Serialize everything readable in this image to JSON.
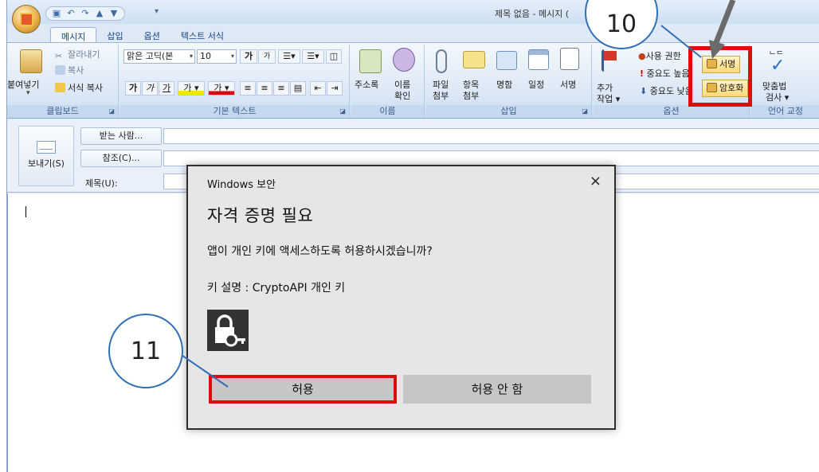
{
  "window": {
    "title": "제목 없음 - 메시지 (",
    "qat_icons": [
      "save-icon",
      "undo-icon",
      "redo-icon",
      "up-icon",
      "down-icon"
    ]
  },
  "tabs": [
    "메시지",
    "삽입",
    "옵션",
    "텍스트 서식"
  ],
  "ribbon": {
    "clipboard": {
      "label": "클립보드",
      "paste": "붙여넣기",
      "cut": "잘라내기",
      "copy": "복사",
      "format_painter": "서식 복사"
    },
    "basic_text": {
      "label": "기본 텍스트",
      "font": "맑은 고딕(본",
      "size": "10",
      "grow": "가",
      "shrink": "가",
      "bold": "가",
      "italic": "가",
      "underline": "가",
      "highlight": "가",
      "font_color": "가"
    },
    "names": {
      "label": "이름",
      "address_book": "주소록",
      "check_names_line1": "이름",
      "check_names_line2": "확인"
    },
    "insert": {
      "label": "삽입",
      "attach_file_line1": "파일",
      "attach_file_line2": "첨부",
      "attach_item_line1": "항목",
      "attach_item_line2": "첨부",
      "business_card": "명함",
      "calendar": "일정",
      "signature": "서명"
    },
    "options": {
      "label": "옵션",
      "follow_up_line1": "추가",
      "follow_up_line2": "작업",
      "permission": "사용 권한",
      "high_importance": "중요도 높음",
      "low_importance": "중요도 낮음",
      "sign_button": "서명",
      "encrypt_button": "암호화"
    },
    "proofing": {
      "label": "언어 교정",
      "spelling_line1": "맞춤법",
      "spelling_line2": "검사"
    }
  },
  "header": {
    "send": "보내기(S)",
    "to": "받는 사람...",
    "cc": "참조(C)...",
    "subject": "제목(U):"
  },
  "dialog": {
    "caption": "Windows 보안",
    "close": "×",
    "heading": "자격 증명 필요",
    "question": "앱이 개인 키에 액세스하도록 허용하시겠습니까?",
    "key_description": "키 설명 : CryptoAPI 개인 키",
    "allow": "허용",
    "deny": "허용 안 함"
  },
  "callouts": {
    "step10": "10",
    "step11": "11"
  },
  "colors": {
    "highlight": "#e10b0b",
    "callout_border": "#2e6fb5",
    "ribbon_bg": "#dbe7f5"
  }
}
